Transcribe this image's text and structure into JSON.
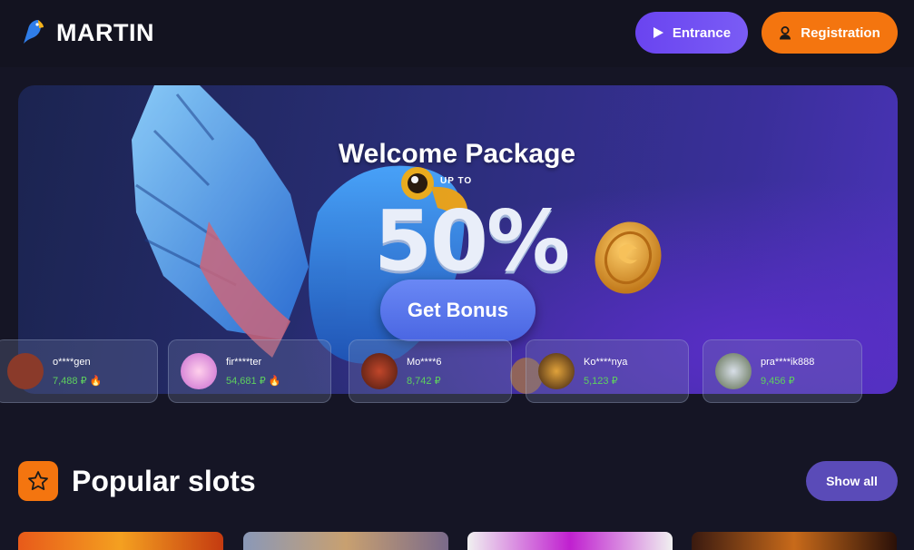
{
  "header": {
    "brand": "MARTIN",
    "entrance_label": "Entrance",
    "registration_label": "Registration"
  },
  "banner": {
    "title": "Welcome Package",
    "upto": "UP TO",
    "percent": "50%",
    "cta_label": "Get Bonus"
  },
  "winners": [
    {
      "name": "o****gen",
      "amount": "7,488 ₽",
      "hot": true
    },
    {
      "name": "fir****ter",
      "amount": "54,681 ₽",
      "hot": true
    },
    {
      "name": "Mo****6",
      "amount": "8,742 ₽",
      "hot": false
    },
    {
      "name": "Ko****nya",
      "amount": "5,123 ₽",
      "hot": false
    },
    {
      "name": "pra****ik888",
      "amount": "9,456 ₽",
      "hot": false
    }
  ],
  "popular": {
    "title": "Popular slots",
    "show_all_label": "Show all"
  },
  "colors": {
    "accent_orange": "#f4750f",
    "accent_purple": "#6a44f0",
    "win_green": "#5ed05e"
  }
}
